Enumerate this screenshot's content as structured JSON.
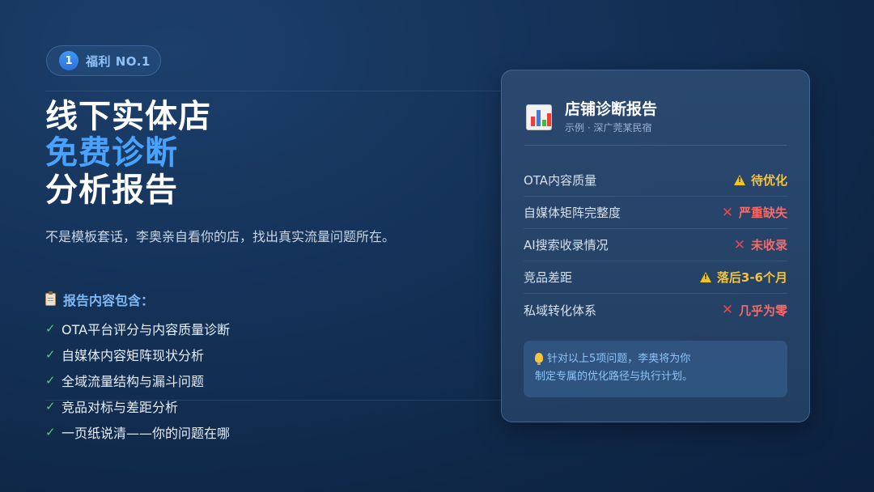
{
  "badge": {
    "number": "1",
    "label": "福利 NO.1"
  },
  "title": {
    "line1": "线下实体店",
    "line2": "免费诊断",
    "line3": "分析报告"
  },
  "subtitle": "不是模板套话，李奥亲自看你的店，找出真实流量问题所在。",
  "contents": {
    "heading": "报告内容包含：",
    "items": [
      "OTA平台评分与内容质量诊断",
      "自媒体内容矩阵现状分析",
      "全域流量结构与漏斗问题",
      "竞品对标与差距分析",
      "一页纸说清——你的问题在哪"
    ]
  },
  "card": {
    "title": "店铺诊断报告",
    "subtitle": "示例 · 深广莞某民宿",
    "rows": [
      {
        "label": "OTA内容质量",
        "status": "待优化",
        "level": "warning"
      },
      {
        "label": "自媒体矩阵完整度",
        "status": "严重缺失",
        "level": "bad"
      },
      {
        "label": "AI搜索收录情况",
        "status": "未收录",
        "level": "bad"
      },
      {
        "label": "竞品差距",
        "status": "落后3-6个月",
        "level": "warning"
      },
      {
        "label": "私域转化体系",
        "status": "几乎为零",
        "level": "bad"
      }
    ],
    "tip": {
      "line1": "针对以上5项问题，李奥将为你",
      "line2": "制定专属的优化路径与执行计划。"
    }
  },
  "colors": {
    "accent": "#4aa2ff",
    "warning": "#f5c23a",
    "bad": "#f26b6b",
    "check": "#4ccf6e"
  },
  "icons": {
    "check": "check-icon",
    "warning": "warning-icon",
    "bad": "x-icon",
    "tip": "lightbulb-icon",
    "report": "bar-chart-icon",
    "clipboard": "clipboard-icon"
  }
}
